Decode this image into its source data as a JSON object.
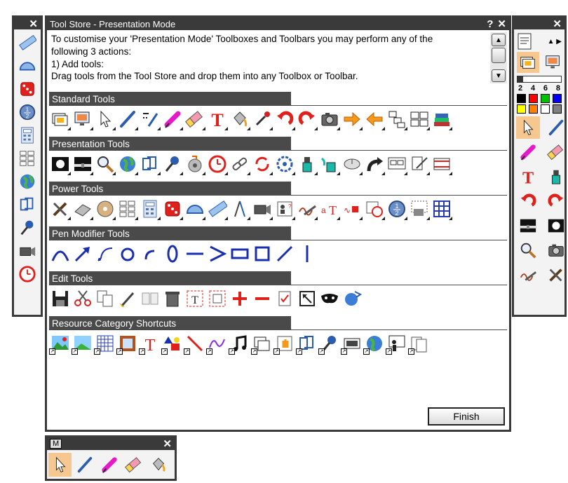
{
  "tool_store": {
    "title": "Tool Store - Presentation Mode",
    "help": "?",
    "close": "✕",
    "description_lines": [
      "To customise your 'Presentation Mode' Toolboxes and Toolbars you may perform any of the",
      "following 3 actions:",
      "1) Add tools:",
      "Drag tools from the Tool Store and drop them into any Toolbox or Toolbar."
    ],
    "sections": [
      {
        "title": "Standard Tools",
        "icons": [
          "flipchart-icon",
          "desktop-icon",
          "select-arrow-icon",
          "pen-icon",
          "pen-style-icon",
          "highlighter-icon",
          "eraser-icon",
          "text-icon",
          "fill-bucket-icon",
          "eyedropper-icon",
          "undo-icon",
          "redo-icon",
          "camera-icon",
          "next-page-icon",
          "previous-page-icon",
          "page-organiser-icon",
          "page-sorter-icon",
          "library-icon"
        ]
      },
      {
        "title": "Presentation Tools",
        "icons": [
          "spotlight-icon",
          "reveal-icon",
          "magnifier-icon",
          "globe-icon",
          "pages-icon",
          "pin-icon",
          "sound-icon",
          "clock-icon",
          "link-icon",
          "refresh-icon",
          "rotate-icon",
          "ink-bottle-icon",
          "ink-splash-icon",
          "mouse-icon",
          "redo-arrow-icon",
          "dual-screen-icon",
          "page-edit-icon",
          "swap-icon"
        ]
      },
      {
        "title": "Power Tools",
        "icons": [
          "tools-icon",
          "ruler-slant-icon",
          "cd-icon",
          "keypad-icon",
          "calculator-icon",
          "dice-icon",
          "protractor-icon",
          "ruler-icon",
          "compass-icon",
          "video-camera-icon",
          "user-info-icon",
          "handwriting-icon",
          "text-convert-icon",
          "shape-convert-icon",
          "calendar-clock-icon",
          "fraction-icon",
          "screen-capture-icon",
          "grid-icon"
        ]
      },
      {
        "title": "Pen Modifier Tools",
        "icons": [
          "freehand-curve-icon",
          "arrow-line-icon",
          "connector-icon",
          "circle-icon",
          "arc-icon",
          "ellipse-icon",
          "line-icon",
          "chevron-icon",
          "rectangle-icon",
          "square-icon",
          "diagonal-line-icon",
          "vertical-line-icon"
        ]
      },
      {
        "title": "Edit Tools",
        "icons": [
          "save-icon",
          "cut-icon",
          "copy-icon",
          "paste-brush-icon",
          "duplicate-icon",
          "delete-bin-icon",
          "text-edit-icon",
          "clone-icon",
          "plus-icon",
          "minus-icon",
          "checklist-icon",
          "crop-icon",
          "mask-icon",
          "web-icon"
        ]
      },
      {
        "title": "Resource Category Shortcuts",
        "icons": [
          "landscape-shortcut-icon",
          "image-shortcut-icon",
          "grid-shortcut-icon",
          "frame-shortcut-icon",
          "text-shortcut-icon",
          "shapes-shortcut-icon",
          "line-shortcut-icon",
          "squiggle-shortcut-icon",
          "music-shortcut-icon",
          "flipchart-shortcut-icon",
          "hand-shortcut-icon",
          "pages-shortcut-icon",
          "pin-shortcut-icon",
          "video-shortcut-icon",
          "globe-shortcut-icon",
          "teacher-shortcut-icon",
          "document-shortcut-icon"
        ]
      }
    ],
    "finish_label": "Finish"
  },
  "left_toolbox": {
    "close": "✕",
    "icons": [
      "ruler-icon",
      "protractor-icon",
      "dice-icon",
      "fraction-icon",
      "calculator-icon",
      "keypad-icon",
      "globe-icon",
      "pages-icon",
      "pin-icon",
      "video-camera-icon",
      "clock-icon"
    ]
  },
  "right_toolbox": {
    "close": "✕",
    "pen_widths": [
      "2",
      "4",
      "6",
      "8"
    ],
    "colors": [
      "#000000",
      "#ff0000",
      "#00c000",
      "#0000ff",
      "#ffff00",
      "#ff8000",
      "#ffffff",
      "#808080"
    ],
    "icons": [
      "select-arrow-icon",
      "pen-icon",
      "highlighter-icon",
      "eraser-icon",
      "text-icon",
      "ink-bottle-icon",
      "undo-icon",
      "redo-icon",
      "reveal-icon",
      "spotlight-icon",
      "magnifier-icon",
      "camera-icon",
      "handwriting-icon",
      "tools-icon"
    ]
  },
  "mini_toolbar": {
    "label": "M",
    "close": "✕",
    "icons": [
      "select-arrow-icon",
      "pen-icon",
      "highlighter-icon",
      "eraser-icon",
      "fill-bucket-icon"
    ]
  }
}
